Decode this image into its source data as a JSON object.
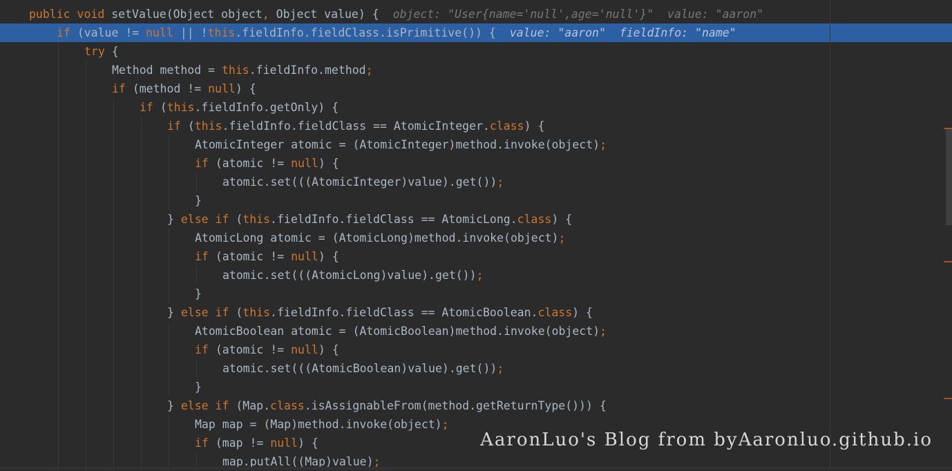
{
  "editor": {
    "lines": [
      {
        "indent": 0,
        "current": false,
        "tokens": [
          [
            "kw",
            "public "
          ],
          [
            "kw",
            "void "
          ],
          [
            "p",
            "setValue(Object object"
          ],
          [
            "kw",
            ", "
          ],
          [
            "p",
            "Object value) {"
          ]
        ],
        "hint": "object: \"User{name='null',age='null'}\"  value: \"aaron\""
      },
      {
        "indent": 1,
        "current": true,
        "tokens": [
          [
            "kw",
            "if "
          ],
          [
            "p",
            "(value != "
          ],
          [
            "kw",
            "null "
          ],
          [
            "p",
            "|| !"
          ],
          [
            "kw",
            "this"
          ],
          [
            "p",
            ".fieldInfo.fieldClass.isPrimitive()) {"
          ]
        ],
        "hint": "value: \"aaron\"  fieldInfo: \"name\""
      },
      {
        "indent": 2,
        "current": false,
        "tokens": [
          [
            "kw",
            "try "
          ],
          [
            "p",
            "{"
          ]
        ],
        "hint": ""
      },
      {
        "indent": 3,
        "current": false,
        "tokens": [
          [
            "p",
            "Method method = "
          ],
          [
            "kw",
            "this"
          ],
          [
            "p",
            ".fieldInfo.method"
          ],
          [
            "kw",
            ";"
          ]
        ],
        "hint": ""
      },
      {
        "indent": 3,
        "current": false,
        "tokens": [
          [
            "kw",
            "if "
          ],
          [
            "p",
            "(method != "
          ],
          [
            "kw",
            "null"
          ],
          [
            "p",
            ") {"
          ]
        ],
        "hint": ""
      },
      {
        "indent": 4,
        "current": false,
        "tokens": [
          [
            "kw",
            "if "
          ],
          [
            "p",
            "("
          ],
          [
            "kw",
            "this"
          ],
          [
            "p",
            ".fieldInfo.getOnly) {"
          ]
        ],
        "hint": ""
      },
      {
        "indent": 5,
        "current": false,
        "tokens": [
          [
            "kw",
            "if "
          ],
          [
            "p",
            "("
          ],
          [
            "kw",
            "this"
          ],
          [
            "p",
            ".fieldInfo.fieldClass == AtomicInteger."
          ],
          [
            "kw",
            "class"
          ],
          [
            "p",
            ") {"
          ]
        ],
        "hint": ""
      },
      {
        "indent": 6,
        "current": false,
        "tokens": [
          [
            "p",
            "AtomicInteger atomic = (AtomicInteger)method.invoke(object)"
          ],
          [
            "kw",
            ";"
          ]
        ],
        "hint": ""
      },
      {
        "indent": 6,
        "current": false,
        "tokens": [
          [
            "kw",
            "if "
          ],
          [
            "p",
            "(atomic != "
          ],
          [
            "kw",
            "null"
          ],
          [
            "p",
            ") {"
          ]
        ],
        "hint": ""
      },
      {
        "indent": 7,
        "current": false,
        "tokens": [
          [
            "p",
            "atomic.set(((AtomicInteger)value).get())"
          ],
          [
            "kw",
            ";"
          ]
        ],
        "hint": ""
      },
      {
        "indent": 6,
        "current": false,
        "tokens": [
          [
            "p",
            "}"
          ]
        ],
        "hint": ""
      },
      {
        "indent": 5,
        "current": false,
        "tokens": [
          [
            "p",
            "} "
          ],
          [
            "kw",
            "else if "
          ],
          [
            "p",
            "("
          ],
          [
            "kw",
            "this"
          ],
          [
            "p",
            ".fieldInfo.fieldClass == AtomicLong."
          ],
          [
            "kw",
            "class"
          ],
          [
            "p",
            ") {"
          ]
        ],
        "hint": ""
      },
      {
        "indent": 6,
        "current": false,
        "tokens": [
          [
            "p",
            "AtomicLong atomic = (AtomicLong)method.invoke(object)"
          ],
          [
            "kw",
            ";"
          ]
        ],
        "hint": ""
      },
      {
        "indent": 6,
        "current": false,
        "tokens": [
          [
            "kw",
            "if "
          ],
          [
            "p",
            "(atomic != "
          ],
          [
            "kw",
            "null"
          ],
          [
            "p",
            ") {"
          ]
        ],
        "hint": ""
      },
      {
        "indent": 7,
        "current": false,
        "tokens": [
          [
            "p",
            "atomic.set(((AtomicLong)value).get())"
          ],
          [
            "kw",
            ";"
          ]
        ],
        "hint": ""
      },
      {
        "indent": 6,
        "current": false,
        "tokens": [
          [
            "p",
            "}"
          ]
        ],
        "hint": ""
      },
      {
        "indent": 5,
        "current": false,
        "tokens": [
          [
            "p",
            "} "
          ],
          [
            "kw",
            "else if "
          ],
          [
            "p",
            "("
          ],
          [
            "kw",
            "this"
          ],
          [
            "p",
            ".fieldInfo.fieldClass == AtomicBoolean."
          ],
          [
            "kw",
            "class"
          ],
          [
            "p",
            ") {"
          ]
        ],
        "hint": ""
      },
      {
        "indent": 6,
        "current": false,
        "tokens": [
          [
            "p",
            "AtomicBoolean atomic = (AtomicBoolean)method.invoke(object)"
          ],
          [
            "kw",
            ";"
          ]
        ],
        "hint": ""
      },
      {
        "indent": 6,
        "current": false,
        "tokens": [
          [
            "kw",
            "if "
          ],
          [
            "p",
            "(atomic != "
          ],
          [
            "kw",
            "null"
          ],
          [
            "p",
            ") {"
          ]
        ],
        "hint": ""
      },
      {
        "indent": 7,
        "current": false,
        "tokens": [
          [
            "p",
            "atomic.set(((AtomicBoolean)value).get())"
          ],
          [
            "kw",
            ";"
          ]
        ],
        "hint": ""
      },
      {
        "indent": 6,
        "current": false,
        "tokens": [
          [
            "p",
            "}"
          ]
        ],
        "hint": ""
      },
      {
        "indent": 5,
        "current": false,
        "tokens": [
          [
            "p",
            "} "
          ],
          [
            "kw",
            "else if "
          ],
          [
            "p",
            "(Map."
          ],
          [
            "kw",
            "class"
          ],
          [
            "p",
            ".isAssignableFrom(method.getReturnType())) {"
          ]
        ],
        "hint": ""
      },
      {
        "indent": 6,
        "current": false,
        "tokens": [
          [
            "p",
            "Map map = (Map)method.invoke(object)"
          ],
          [
            "kw",
            ";"
          ]
        ],
        "hint": ""
      },
      {
        "indent": 6,
        "current": false,
        "tokens": [
          [
            "kw",
            "if "
          ],
          [
            "p",
            "(map != "
          ],
          [
            "kw",
            "null"
          ],
          [
            "p",
            ") {"
          ]
        ],
        "hint": ""
      },
      {
        "indent": 7,
        "current": false,
        "tokens": [
          [
            "p",
            "map.putAll((Map)value)"
          ],
          [
            "kw",
            ";"
          ]
        ],
        "hint": ""
      }
    ]
  },
  "watermark": "AaronLuo's Blog from byAaronluo.github.io",
  "colors": {
    "background": "#2b2b2b",
    "keyword": "#cc7832",
    "text": "#a9b7c6",
    "current_line": "#2d5fa3",
    "hint": "#787878"
  }
}
